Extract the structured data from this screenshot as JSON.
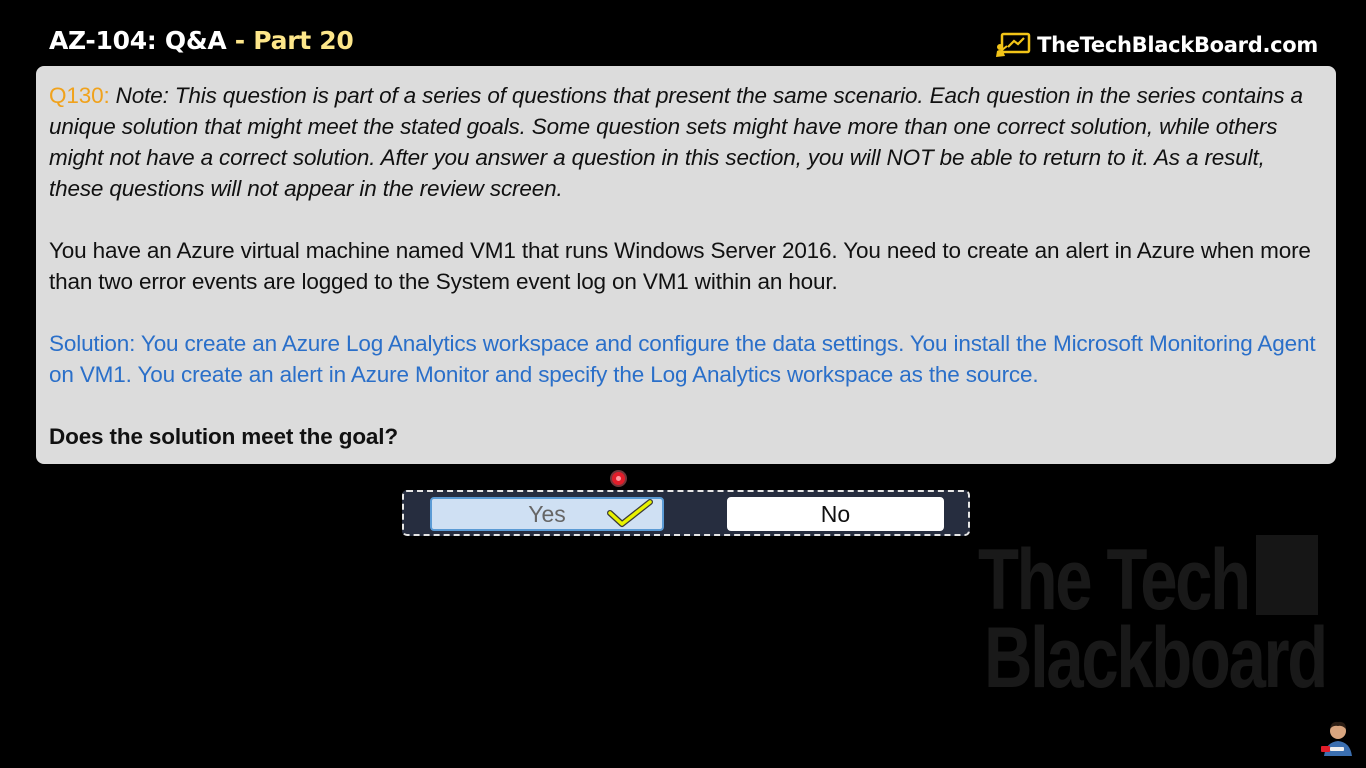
{
  "header": {
    "title_main": "AZ-104: Q&A",
    "title_sep": " - ",
    "title_part": "Part 20",
    "brand_text": "TheTechBlackBoard.com"
  },
  "question": {
    "number": "Q130:",
    "note": "Note: This question is part of a series of questions that present the same scenario. Each question in the series contains a unique solution that might meet the stated goals. Some question sets might have more than one correct solution, while others might not have a correct solution. After you answer a question in this section, you will NOT be able to return to it. As a result, these questions will not appear in the review screen.",
    "scenario": "You have an Azure virtual machine named VM1 that runs Windows Server 2016. You need to create an alert in Azure when more than two error events are logged to the System event log on VM1 within an hour.",
    "solution": "Solution: You create an Azure Log Analytics workspace and configure the data settings. You install the Microsoft Monitoring Agent on VM1. You create an alert in Azure Monitor and specify the Log Analytics workspace as the source.",
    "prompt": "Does the solution meet the goal?"
  },
  "answers": {
    "yes_label": "Yes",
    "no_label": "No",
    "selected": "Yes"
  },
  "watermark": {
    "line1": "The Tech",
    "line2": "Blackboard"
  },
  "colors": {
    "question_number": "#f0a21c",
    "solution_text": "#2a6fc9",
    "title_part": "#fde68a",
    "selected_fill": "#cfe0f3",
    "checkmark": "#e8f200"
  },
  "icons": {
    "brand": "whiteboard-icon",
    "check": "checkmark-icon",
    "cursor": "cursor-highlight-icon"
  }
}
